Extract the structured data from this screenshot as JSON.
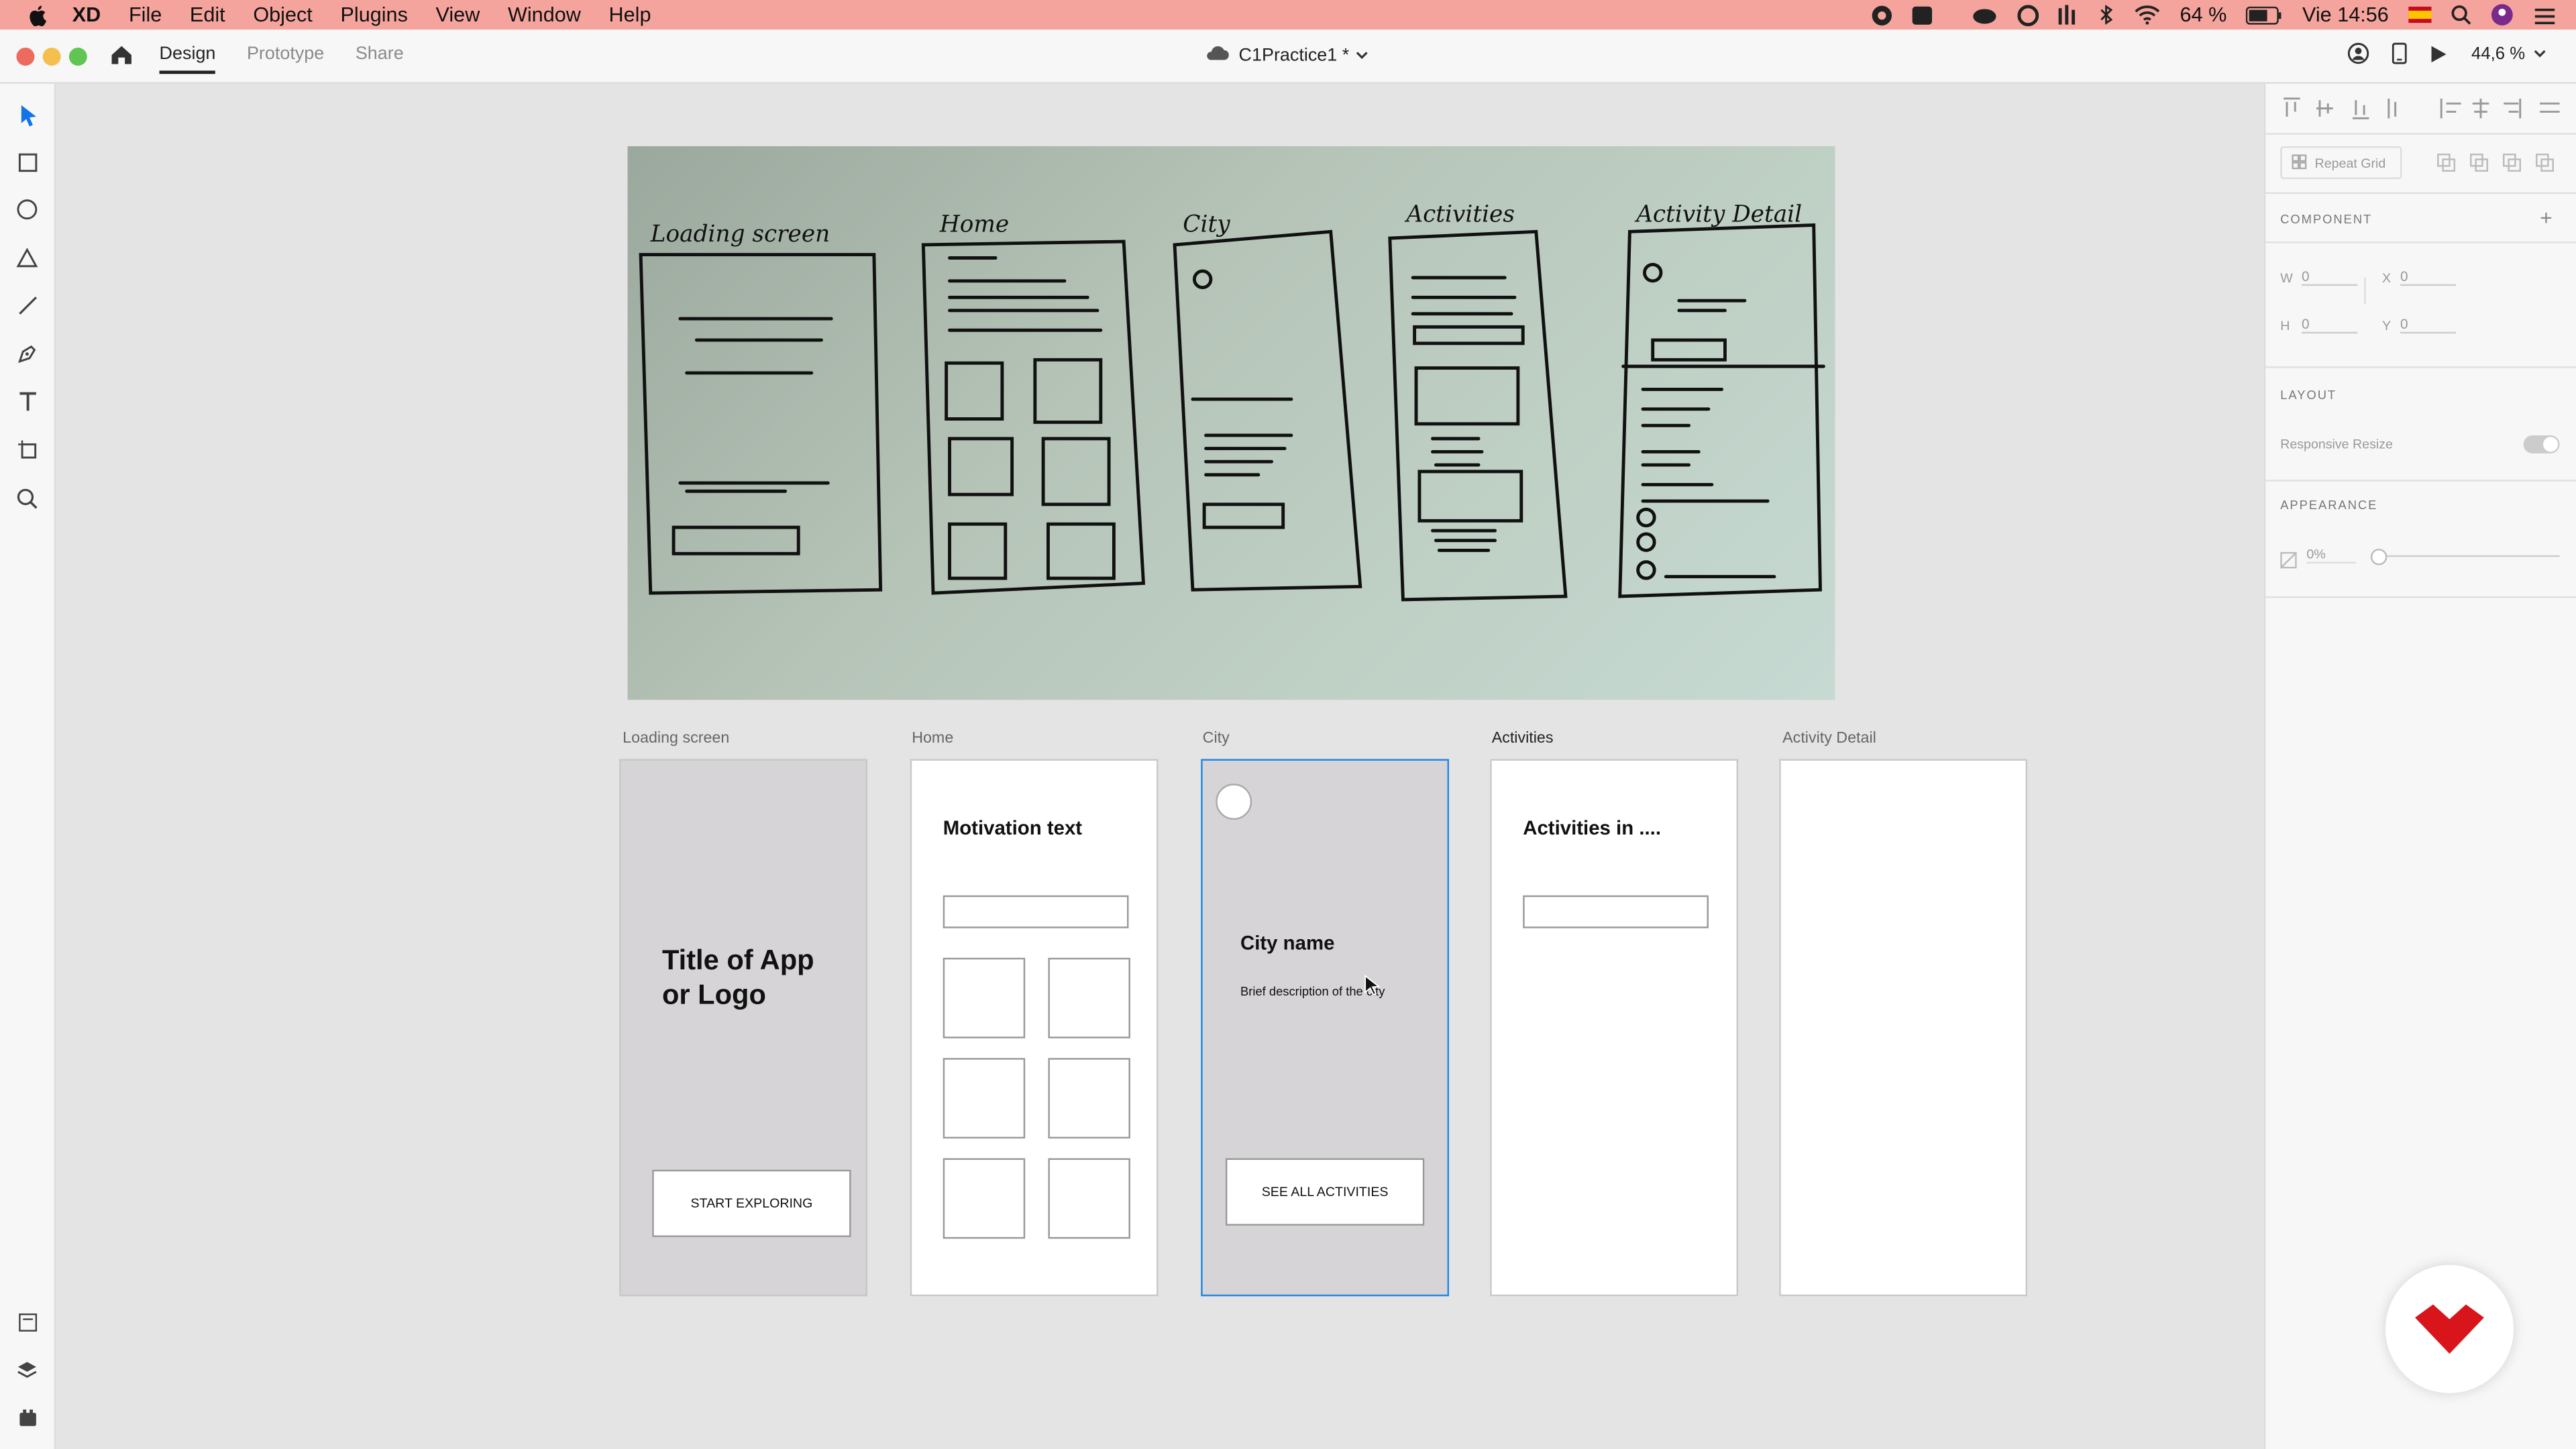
{
  "menubar": {
    "app": "XD",
    "items": [
      "File",
      "Edit",
      "Object",
      "Plugins",
      "View",
      "Window",
      "Help"
    ],
    "battery": "64 %",
    "clock": "Vie 14:56"
  },
  "titlebar": {
    "tabs": [
      "Design",
      "Prototype",
      "Share"
    ],
    "document": "C1Practice1 *",
    "zoom": "44,6 %"
  },
  "panel": {
    "repeat_grid": "Repeat Grid",
    "component": "COMPONENT",
    "w_label": "W",
    "w_value": "0",
    "x_label": "X",
    "x_value": "0",
    "h_label": "H",
    "h_value": "0",
    "y_label": "Y",
    "y_value": "0",
    "layout": "LAYOUT",
    "responsive_resize": "Responsive Resize",
    "appearance": "APPEARANCE",
    "opacity": "0%"
  },
  "sketch": {
    "labels": [
      "Loading screen",
      "Home",
      "City",
      "Activities",
      "Activity Detail"
    ]
  },
  "artboards": {
    "loading": {
      "label": "Loading screen",
      "title": "Title of App or Logo",
      "button": "START EXPLORING"
    },
    "home": {
      "label": "Home",
      "heading": "Motivation text"
    },
    "city": {
      "label": "City",
      "heading": "City name",
      "description": "Brief description of the city",
      "button": "SEE ALL ACTIVITIES"
    },
    "activities": {
      "label": "Activities",
      "heading": "Activities in ...."
    },
    "detail": {
      "label": "Activity Detail"
    }
  },
  "colors": {
    "menubar": "#f4a49c",
    "selection": "#1e88e5",
    "brand_logo": "#d8151b"
  }
}
